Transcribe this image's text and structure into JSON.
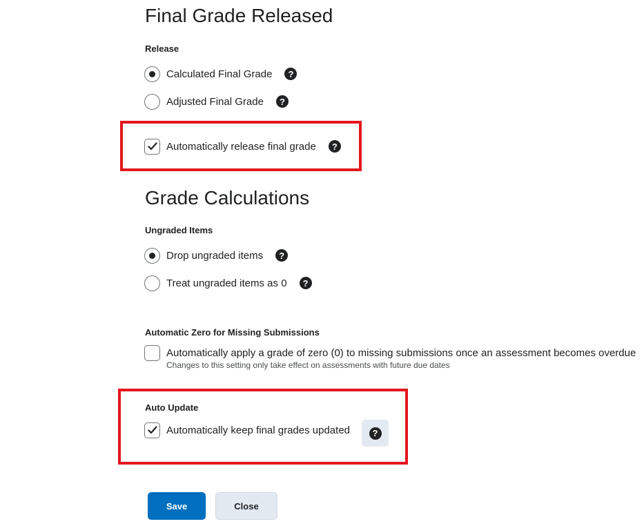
{
  "final_grade_released": {
    "title": "Final Grade Released",
    "release_label": "Release",
    "options": [
      {
        "label": "Calculated Final Grade",
        "selected": true
      },
      {
        "label": "Adjusted Final Grade",
        "selected": false
      }
    ],
    "auto_release": {
      "label": "Automatically release final grade",
      "checked": true
    }
  },
  "grade_calculations": {
    "title": "Grade Calculations",
    "ungraded_label": "Ungraded Items",
    "options": [
      {
        "label": "Drop ungraded items",
        "selected": true
      },
      {
        "label": "Treat ungraded items as 0",
        "selected": false
      }
    ],
    "auto_zero": {
      "section_label": "Automatic Zero for Missing Submissions",
      "label": "Automatically apply a grade of zero (0) to missing submissions once an assessment becomes overdue",
      "note": "Changes to this setting only take effect on assessments with future due dates",
      "checked": false
    },
    "auto_update": {
      "section_label": "Auto Update",
      "label": "Automatically keep final grades updated",
      "checked": true
    }
  },
  "help_icon": "question-mark-icon",
  "help_glyph": "?",
  "buttons": {
    "save": "Save",
    "close": "Close"
  },
  "colors": {
    "primary": "#006fbf",
    "highlight": "#e3171d",
    "secondary_button": "#e3e9f1",
    "text": "#202122"
  }
}
